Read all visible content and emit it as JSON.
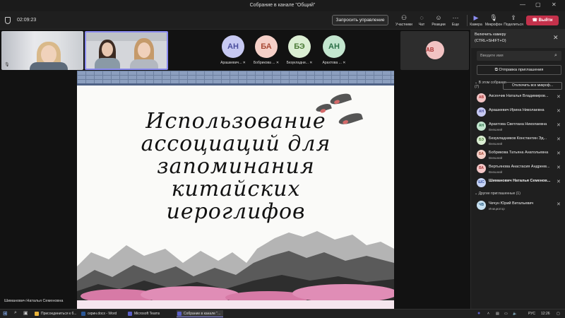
{
  "window": {
    "title": "Собрание в канале \"Общий\""
  },
  "toolbar": {
    "timer": "02:09:23",
    "request_control": "Запросить управление",
    "items": [
      {
        "label": "Участники",
        "icon": "people-icon"
      },
      {
        "label": "Чат",
        "icon": "chat-icon"
      },
      {
        "label": "Реакции",
        "icon": "reactions-icon"
      },
      {
        "label": "Еще",
        "icon": "more-icon"
      },
      {
        "label": "Камера",
        "icon": "camera-icon"
      },
      {
        "label": "Микрофон",
        "icon": "mic-icon"
      },
      {
        "label": "Поделиться",
        "icon": "share-icon"
      }
    ],
    "leave": "Выйти"
  },
  "gallery": [
    {
      "initials": "АН",
      "name": "Арашкевич..."
    },
    {
      "initials": "БА",
      "name": "Бобрикова ..."
    },
    {
      "initials": "БЭ",
      "name": "Безукладни..."
    },
    {
      "initials": "АН",
      "name": "Арахтова ..."
    }
  ],
  "spotlight": {
    "initials": "АВ"
  },
  "slide": {
    "title": "Использование ассоциаций для запоминания китайских иероглифов"
  },
  "speaker_label": "Шиманович Наталья Семеновна",
  "panel": {
    "camera_tip": "Включить камеру",
    "camera_shortcut": "(CTRL+SHIFT+O)",
    "invite_placeholder": "Введите имя",
    "share_invite": "Отправка приглашения",
    "in_meeting": "В этом собрании",
    "in_meeting_count": "(7)",
    "mute_all": "Отключить все микроф...",
    "others": "Другие приглашенные (1)",
    "participants": [
      {
        "initials": "АВ",
        "name": "Аксенчик Наталья Владимиров...",
        "sub": "",
        "bg": "#f2c3c3",
        "fg": "#a33"
      },
      {
        "initials": "АН",
        "name": "Арашкевич Ирина Николаевна",
        "sub": "",
        "bg": "#c7c9f2",
        "fg": "#4a4d9c"
      },
      {
        "initials": "АН",
        "name": "Арахтова Светлана Николаевна",
        "sub": "Внешний",
        "bg": "#c3e6cf",
        "fg": "#2b7047"
      },
      {
        "initials": "БЭ",
        "name": "Безукладников Константин Эд...",
        "sub": "Внешний",
        "bg": "#dbeed3",
        "fg": "#4a7a35"
      },
      {
        "initials": "БА",
        "name": "Бобрикова Татьяна Анатольевна",
        "sub": "Внешний",
        "bg": "#f5d0c8",
        "fg": "#a84a35"
      },
      {
        "initials": "ВА",
        "name": "Вертьянова Анастасия Андреев...",
        "sub": "Внешний",
        "bg": "#f5c8c8",
        "fg": "#a33a3a"
      },
      {
        "initials": "ШС",
        "name": "Шиманович Наталья Семенов...",
        "sub": "",
        "bg": "#c7d4f5",
        "fg": "#3a55a3"
      }
    ],
    "invited": [
      {
        "initials": "ЧВ",
        "name": "Чечун Юрий Витальевич",
        "sub": "Инициатор",
        "bg": "#c7e0f0",
        "fg": "#2a5f85"
      }
    ]
  },
  "taskbar": {
    "tasks": [
      "Присоединиться к б...",
      "скрин.docx - Word",
      "Microsoft Teams",
      "Собрание в канале \"..."
    ],
    "lang": "РУС",
    "clock": "12:26"
  },
  "colors": {
    "accent": "#8b8cf0",
    "leave": "#c4314b"
  }
}
